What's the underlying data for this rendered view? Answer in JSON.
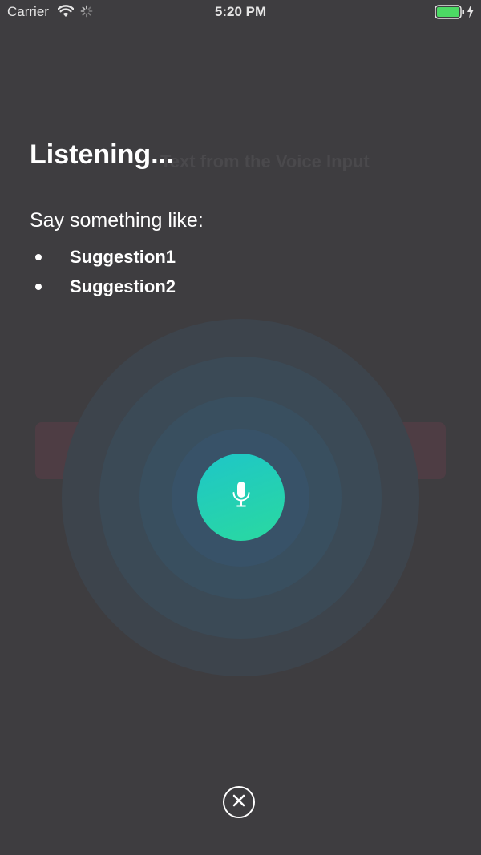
{
  "status_bar": {
    "carrier": "Carrier",
    "time": "5:20 PM",
    "wifi_icon": "wifi-icon",
    "activity_icon": "activity-indicator-icon",
    "battery_icon": "battery-icon",
    "charging_icon": "charging-bolt-icon",
    "battery_color": "#4cd964"
  },
  "background": {
    "label": "Text from the Voice Input"
  },
  "overlay": {
    "title": "Listening...",
    "prompt": "Say something like:",
    "suggestions": [
      "Suggestion1",
      "Suggestion2"
    ],
    "mic_icon": "microphone-icon",
    "close_icon": "close-icon",
    "accent_gradient": [
      "#1ec6c8",
      "#2ad9a0"
    ],
    "dim_background": "#3e3d40"
  }
}
